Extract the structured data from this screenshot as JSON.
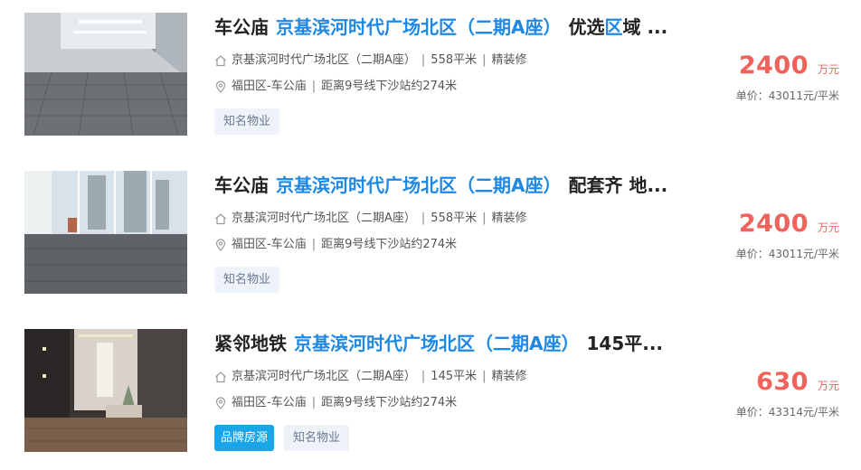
{
  "listings": [
    {
      "title_prefix": "车公庙",
      "title_building": "京基滨河时代广场北区（二期A座）",
      "title_suffix": "优选",
      "title_suffix_highlight": "区",
      "title_suffix_tail": "域 ...",
      "address": "京基滨河时代广场北区（二期A座）",
      "area": "558平米",
      "decoration": "精装修",
      "district": "福田区-车公庙",
      "distance": "距离9号线下沙站约274米",
      "tags": [
        "知名物业"
      ],
      "price": "2400",
      "price_unit": "万元",
      "unit_price": "单价：43011元/平米"
    },
    {
      "title_prefix": "车公庙",
      "title_building": "京基滨河时代广场北区（二期A座）",
      "title_suffix": "配套齐 地...",
      "title_suffix_highlight": "",
      "title_suffix_tail": "",
      "address": "京基滨河时代广场北区（二期A座）",
      "area": "558平米",
      "decoration": "精装修",
      "district": "福田区-车公庙",
      "distance": "距离9号线下沙站约274米",
      "tags": [
        "知名物业"
      ],
      "price": "2400",
      "price_unit": "万元",
      "unit_price": "单价：43011元/平米"
    },
    {
      "title_prefix": "紧邻地铁",
      "title_building": "京基滨河时代广场北区（二期A座）",
      "title_suffix": "145平...",
      "title_suffix_highlight": "",
      "title_suffix_tail": "",
      "address": "京基滨河时代广场北区（二期A座）",
      "area": "145平米",
      "decoration": "精装修",
      "district": "福田区-车公庙",
      "distance": "距离9号线下沙站约274米",
      "brand_tag": "品牌房源",
      "tags": [
        "知名物业"
      ],
      "price": "630",
      "price_unit": "万元",
      "unit_price": "单价：43314元/平米"
    }
  ],
  "icons": {
    "house": "house-icon",
    "location": "location-pin-icon"
  },
  "colors": {
    "price": "#f0625a",
    "title_link": "#1e88e5",
    "brand_tag": "#1aa5e8"
  }
}
